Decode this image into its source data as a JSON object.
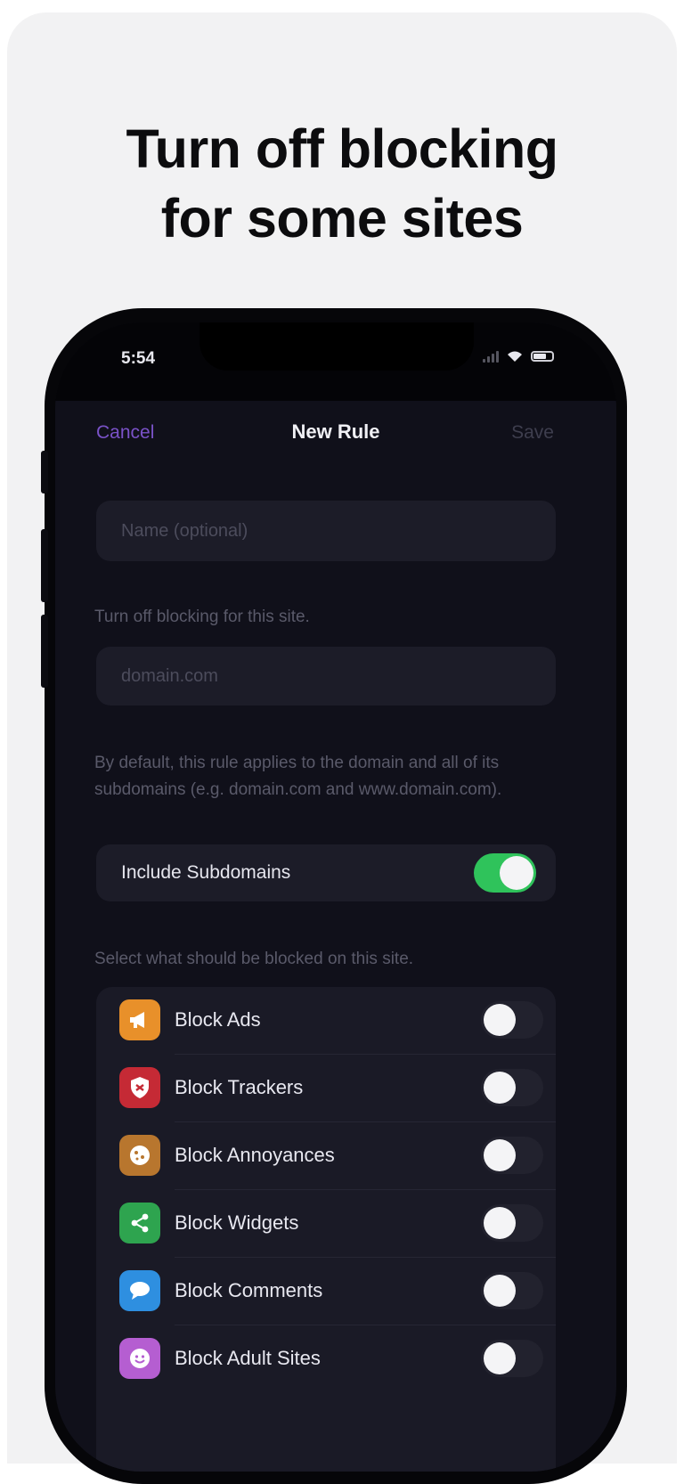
{
  "headline": {
    "line1": "Turn off blocking",
    "line2": "for some sites"
  },
  "status_bar": {
    "time": "5:54"
  },
  "nav": {
    "cancel": "Cancel",
    "title": "New Rule",
    "save": "Save"
  },
  "form": {
    "name_placeholder": "Name (optional)",
    "site_caption": "Turn off blocking for this site.",
    "domain_placeholder": "domain.com",
    "subdomain_note": "By default, this rule applies to the domain and all of its subdomains (e.g. domain.com and www.domain.com).",
    "include_subdomains": {
      "label": "Include Subdomains",
      "enabled": true
    },
    "block_caption": "Select what should be blocked on this site."
  },
  "block_options": [
    {
      "label": "Block Ads",
      "icon": "megaphone-icon",
      "icon_color": "#e8902a",
      "enabled": false
    },
    {
      "label": "Block Trackers",
      "icon": "shield-icon",
      "icon_color": "#c52a35",
      "enabled": false
    },
    {
      "label": "Block Annoyances",
      "icon": "cookie-icon",
      "icon_color": "#b8762e",
      "enabled": false
    },
    {
      "label": "Block Widgets",
      "icon": "share-icon",
      "icon_color": "#2ea44f",
      "enabled": false
    },
    {
      "label": "Block Comments",
      "icon": "chat-bubble-icon",
      "icon_color": "#2e8fe0",
      "enabled": false
    },
    {
      "label": "Block Adult Sites",
      "icon": "smiley-icon",
      "icon_color": "#b55ed1",
      "enabled": false
    }
  ],
  "colors": {
    "accent": "#7a52c8",
    "toggle_on": "#2fc35b",
    "background": "#10101a"
  }
}
